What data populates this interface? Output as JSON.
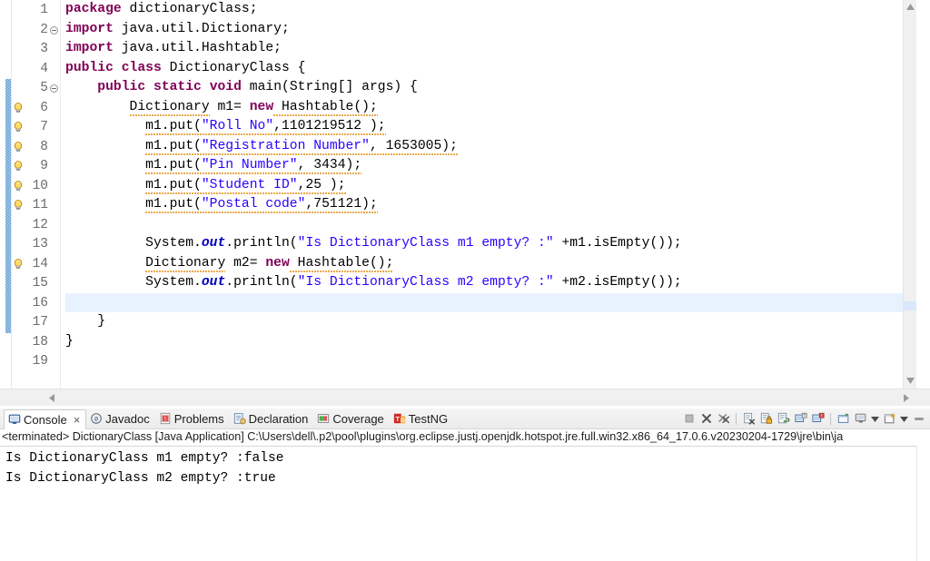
{
  "editor": {
    "name": "java-source-editor",
    "current_line": 16,
    "total_lines_visible": 19,
    "change_bar_start_line": 5,
    "change_bar_end_line": 17,
    "warning_lines": [
      6,
      7,
      8,
      9,
      10,
      11,
      14
    ],
    "fold_lines": [
      2,
      5
    ],
    "line_numbers": [
      "1",
      "2",
      "3",
      "4",
      "5",
      "6",
      "7",
      "8",
      "9",
      "10",
      "11",
      "12",
      "13",
      "14",
      "15",
      "16",
      "17",
      "18",
      "19"
    ],
    "lines": [
      {
        "n": 1,
        "text": "package dictionaryClass;"
      },
      {
        "n": 2,
        "text": "import java.util.Dictionary;"
      },
      {
        "n": 3,
        "text": "import java.util.Hashtable;"
      },
      {
        "n": 4,
        "text": "public class DictionaryClass {"
      },
      {
        "n": 5,
        "text": "    public static void main(String[] args) {"
      },
      {
        "n": 6,
        "text": "        Dictionary m1= new Hashtable();"
      },
      {
        "n": 7,
        "text": "          m1.put(\"Roll No\",1101219512 );"
      },
      {
        "n": 8,
        "text": "          m1.put(\"Registration Number\", 1653005);"
      },
      {
        "n": 9,
        "text": "          m1.put(\"Pin Number\", 3434);"
      },
      {
        "n": 10,
        "text": "          m1.put(\"Student ID\",25 );"
      },
      {
        "n": 11,
        "text": "          m1.put(\"Postal code\",751121);"
      },
      {
        "n": 12,
        "text": ""
      },
      {
        "n": 13,
        "text": "          System.out.println(\"Is DictionaryClass m1 empty? :\" +m1.isEmpty());"
      },
      {
        "n": 14,
        "text": "          Dictionary m2= new Hashtable();"
      },
      {
        "n": 15,
        "text": "          System.out.println(\"Is DictionaryClass m2 empty? :\" +m2.isEmpty());"
      },
      {
        "n": 16,
        "text": ""
      },
      {
        "n": 17,
        "text": "    }"
      },
      {
        "n": 18,
        "text": "}"
      },
      {
        "n": 19,
        "text": ""
      }
    ],
    "tokens": {
      "l1_kw": "package",
      "l1_rest": " dictionaryClass;",
      "l2_kw": "import",
      "l2_rest": " java.util.Dictionary;",
      "l3_kw": "import",
      "l3_rest": " java.util.Hashtable;",
      "l4_kw1": "public",
      "l4_kw2": "class",
      "l4_rest": " DictionaryClass {",
      "l5_kw1": "public",
      "l5_kw2": "static",
      "l5_kw3": "void",
      "l5_rest": " main(String[] args) {",
      "l6_type": "Dictionary",
      "l6_mid": " m1= ",
      "l6_kw": "new",
      "l6_rest": " Hashtable();",
      "l7_pre": "m1.put(",
      "l7_str": "\"Roll No\"",
      "l7_post": ",1101219512 );",
      "l8_pre": "m1.put(",
      "l8_str": "\"Registration Number\"",
      "l8_post": ", 1653005);",
      "l9_pre": "m1.put(",
      "l9_str": "\"Pin Number\"",
      "l9_post": ", 3434);",
      "l10_pre": "m1.put(",
      "l10_str": "\"Student ID\"",
      "l10_post": ",25 );",
      "l11_pre": "m1.put(",
      "l11_str": "\"Postal code\"",
      "l11_post": ",751121);",
      "l13_sys": "System.",
      "l13_out": "out",
      "l13_pr": ".println(",
      "l13_str": "\"Is DictionaryClass m1 empty? :\"",
      "l13_post": " +m1.isEmpty());",
      "l14_type": "Dictionary",
      "l14_mid": " m2= ",
      "l14_kw": "new",
      "l14_rest": " Hashtable();",
      "l15_sys": "System.",
      "l15_out": "out",
      "l15_pr": ".println(",
      "l15_str": "\"Is DictionaryClass m2 empty? :\"",
      "l15_post": " +m2.isEmpty());",
      "l17_rest": "}",
      "l18_rest": "}"
    }
  },
  "console": {
    "tabs": [
      {
        "label": "Console",
        "icon": "console-icon",
        "active": true,
        "closable": true,
        "close_label": "×"
      },
      {
        "label": "Javadoc",
        "icon": "javadoc-icon",
        "active": false,
        "closable": false
      },
      {
        "label": "Problems",
        "icon": "problems-icon",
        "active": false,
        "closable": false
      },
      {
        "label": "Declaration",
        "icon": "declaration-icon",
        "active": false,
        "closable": false
      },
      {
        "label": "Coverage",
        "icon": "coverage-icon",
        "active": false,
        "closable": false
      },
      {
        "label": "TestNG",
        "icon": "testng-icon",
        "active": false,
        "closable": false
      }
    ],
    "toolbar": [
      {
        "name": "terminate-button",
        "icon": "stop-square-icon"
      },
      {
        "name": "remove-launch-button",
        "icon": "remove-x-icon"
      },
      {
        "name": "remove-all-terminated-button",
        "icon": "remove-all-xx-icon"
      },
      {
        "name": "clear-console-button",
        "icon": "clear-console-icon"
      },
      {
        "name": "scroll-lock-button",
        "icon": "scroll-lock-icon"
      },
      {
        "name": "word-wrap-button",
        "icon": "word-wrap-icon"
      },
      {
        "name": "show-console-on-output-button",
        "icon": "show-console-output-icon"
      },
      {
        "name": "show-console-on-error-button",
        "icon": "show-console-error-icon"
      },
      {
        "name": "pin-console-button",
        "icon": "pin-console-icon"
      },
      {
        "name": "display-selected-console-button",
        "icon": "display-console-icon"
      },
      {
        "name": "display-selected-console-dropdown",
        "icon": "chevron-down-icon"
      },
      {
        "name": "open-console-button",
        "icon": "new-console-icon"
      },
      {
        "name": "open-console-dropdown",
        "icon": "chevron-down-icon"
      },
      {
        "name": "minimize-panel-button",
        "icon": "minimize-icon"
      }
    ],
    "launch_header": "<terminated> DictionaryClass [Java Application] C:\\Users\\dell\\.p2\\pool\\plugins\\org.eclipse.justj.openjdk.hotspot.jre.full.win32.x86_64_17.0.6.v20230204-1729\\jre\\bin\\ja",
    "output": [
      "Is DictionaryClass m1 empty? :false",
      "Is DictionaryClass m2 empty? :true"
    ]
  },
  "colors": {
    "keyword": "#7f0055",
    "string": "#2a00ff",
    "static_field": "#0000c0",
    "current_line_highlight": "#e8f2fe",
    "change_bar": "#5b9bd5",
    "text": "#000000",
    "line_number": "#6b6b6b",
    "panel_bg": "#f0f0f0"
  }
}
